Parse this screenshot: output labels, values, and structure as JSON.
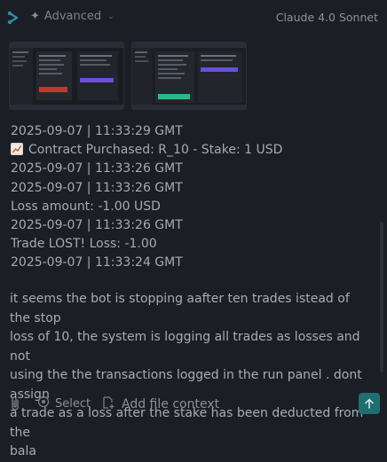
{
  "header": {
    "mode_label": "Advanced",
    "model_label": "Claude 4.0 Sonnet",
    "icons": [
      "app-logo-icon",
      "sparkle-icon",
      "chevron-down-icon"
    ]
  },
  "attachments": [
    {
      "name": "screenshot-1"
    },
    {
      "name": "screenshot-2"
    }
  ],
  "log_lines": [
    {
      "text": "2025-09-07 | 11:33:29 GMT"
    },
    {
      "text": "Contract Purchased: R_10 - Stake: 1 USD",
      "icon": "chart-increasing-emoji"
    },
    {
      "text": "2025-09-07 | 11:33:26 GMT"
    },
    {
      "text": "2025-09-07 | 11:33:26 GMT"
    },
    {
      "text": "Loss amount: -1.00 USD"
    },
    {
      "text": "2025-09-07 | 11:33:26 GMT"
    },
    {
      "text": "Trade LOST! Loss: -1.00"
    },
    {
      "text": "2025-09-07 | 11:33:24 GMT"
    }
  ],
  "message": {
    "lines": [
      "it seems the bot is stopping aafter ten trades istead of the stop",
      "loss of 10, the system is logging all trades as losses and not",
      "using the  the transactions logged in the run panel . dont assign",
      "a trade as a loss after  the stake has been deducted from the",
      "bala"
    ]
  },
  "footer": {
    "select_label": "Select",
    "add_context_label": "Add file context",
    "icons": [
      "paperclip-icon",
      "target-icon",
      "add-file-icon",
      "arrow-up-icon"
    ]
  },
  "colors": {
    "background": "#1b1e24",
    "text": "#a6aab3",
    "send_button": "#1f6f72",
    "accent_purple": "#6b4fd8",
    "accent_green": "#2eb88a"
  }
}
